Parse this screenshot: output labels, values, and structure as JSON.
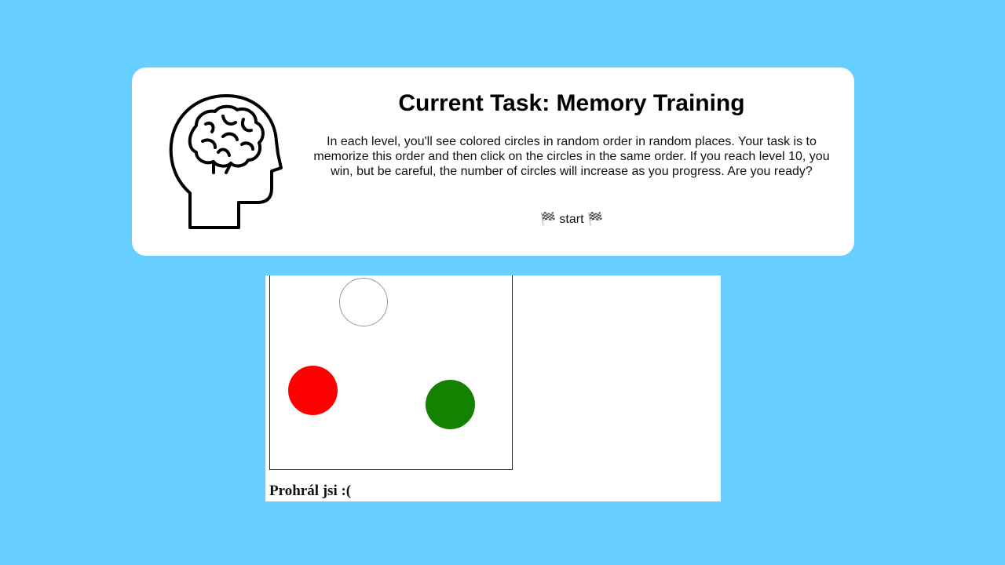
{
  "task": {
    "title": "Current Task: Memory Training",
    "description": "In each level, you'll see colored circles in random order in random places. Your task is to memorize this order and then click on the circles in the same order. If you reach level 10, you win, but be careful, the number of circles will increase as you progress. Are you ready?",
    "start_label": "🏁 start 🏁",
    "icon": "brain-head-icon"
  },
  "game": {
    "circles": [
      {
        "color": "#ffffff",
        "name": "white"
      },
      {
        "color": "#ff0000",
        "name": "red"
      },
      {
        "color": "#148100",
        "name": "green"
      }
    ],
    "status_text": "Prohrál jsi :("
  },
  "colors": {
    "background": "#66cfff",
    "card": "#ffffff"
  }
}
